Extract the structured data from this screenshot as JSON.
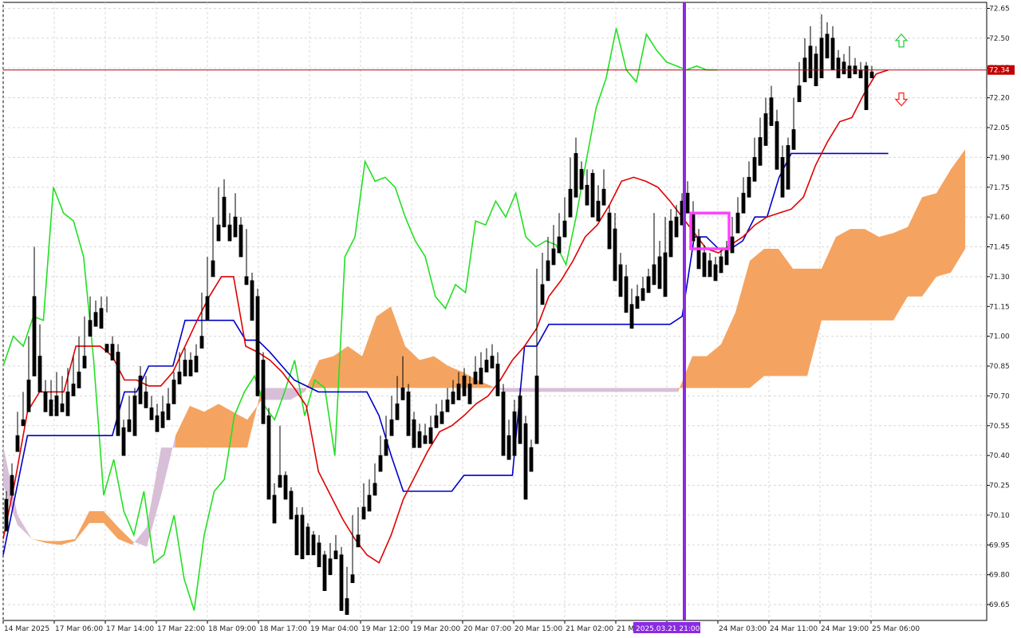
{
  "chart_data": {
    "type": "candlestick",
    "y_axis": {
      "min": 69.57,
      "max": 72.68,
      "ticks": [
        "72.65",
        "72.50",
        "72.35",
        "72.20",
        "72.05",
        "71.90",
        "71.75",
        "71.60",
        "71.45",
        "71.30",
        "71.15",
        "71.00",
        "70.85",
        "70.70",
        "70.55",
        "70.40",
        "70.25",
        "70.10",
        "69.95",
        "69.80",
        "69.65"
      ],
      "current_price": "72.34"
    },
    "x_axis": {
      "labels": [
        "14 Mar 2025",
        "17 Mar 06:00",
        "17 Mar 14:00",
        "17 Mar 22:00",
        "18 Mar 09:00",
        "18 Mar 17:00",
        "19 Mar 04:00",
        "19 Mar 12:00",
        "19 Mar 20:00",
        "20 Mar 07:00",
        "20 Mar 15:00",
        "21 Mar 02:00",
        "21 Mar 10:00",
        "2025.03.21 21:00",
        "24 Mar 03:00",
        "24 Mar 11:00",
        "24 Mar 19:00",
        "25 Mar 06:00"
      ],
      "highlight_label": "2025.03.21 21:00"
    },
    "grid": true,
    "candles": [
      [
        70.18,
        70.22,
        70.05,
        70.02
      ],
      [
        70.3,
        70.36,
        70.22,
        70.2
      ],
      [
        70.5,
        70.62,
        70.44,
        70.42
      ],
      [
        70.58,
        70.72,
        70.56,
        70.55
      ],
      [
        70.78,
        71.0,
        70.65,
        70.62
      ],
      [
        71.2,
        71.45,
        70.82,
        70.8
      ],
      [
        70.9,
        71.06,
        70.78,
        70.72
      ],
      [
        70.72,
        70.78,
        70.66,
        70.62
      ],
      [
        70.68,
        70.78,
        70.62,
        70.6
      ],
      [
        70.7,
        70.82,
        70.62,
        70.6
      ],
      [
        70.66,
        70.8,
        70.66,
        70.62
      ],
      [
        70.72,
        70.84,
        70.66,
        70.6
      ],
      [
        70.76,
        70.9,
        70.72,
        70.7
      ],
      [
        70.82,
        71.0,
        70.76,
        70.74
      ],
      [
        70.9,
        71.1,
        70.88,
        70.84
      ],
      [
        71.08,
        71.2,
        71.05,
        71.0
      ],
      [
        71.12,
        71.18,
        71.1,
        71.05
      ],
      [
        71.14,
        71.2,
        71.12,
        71.04
      ],
      [
        70.96,
        71.2,
        71.12,
        70.92
      ],
      [
        70.96,
        71.0,
        70.92,
        70.88
      ],
      [
        70.92,
        70.96,
        70.52,
        70.5
      ],
      [
        70.54,
        70.58,
        70.5,
        70.4
      ],
      [
        70.58,
        70.7,
        70.56,
        70.52
      ],
      [
        70.7,
        70.74,
        70.54,
        70.5
      ],
      [
        70.8,
        70.85,
        70.7,
        70.66
      ],
      [
        70.72,
        70.8,
        70.68,
        70.64
      ],
      [
        70.64,
        70.7,
        70.6,
        70.58
      ],
      [
        70.6,
        70.66,
        70.56,
        70.52
      ],
      [
        70.62,
        70.7,
        70.58,
        70.54
      ],
      [
        70.66,
        70.74,
        70.62,
        70.58
      ],
      [
        70.78,
        70.82,
        70.7,
        70.66
      ],
      [
        70.82,
        70.92,
        70.8,
        70.76
      ],
      [
        70.88,
        70.94,
        70.84,
        70.8
      ],
      [
        70.88,
        70.92,
        70.84,
        70.8
      ],
      [
        70.9,
        70.96,
        70.88,
        70.82
      ],
      [
        71.0,
        71.22,
        70.98,
        70.94
      ],
      [
        71.2,
        71.4,
        71.1,
        71.08
      ],
      [
        71.38,
        71.6,
        71.34,
        71.3
      ],
      [
        71.56,
        71.75,
        71.52,
        71.48
      ],
      [
        71.7,
        71.79,
        71.58,
        71.55
      ],
      [
        71.56,
        71.62,
        71.52,
        71.48
      ],
      [
        71.6,
        71.72,
        71.58,
        71.5
      ],
      [
        71.56,
        71.6,
        71.44,
        71.4
      ],
      [
        71.3,
        71.54,
        71.3,
        71.26
      ],
      [
        71.28,
        71.32,
        71.12,
        71.08
      ],
      [
        71.2,
        71.24,
        70.98,
        70.7
      ],
      [
        70.88,
        70.92,
        70.6,
        70.56
      ],
      [
        70.6,
        70.64,
        70.22,
        70.18
      ],
      [
        70.2,
        70.26,
        70.1,
        70.06
      ],
      [
        70.3,
        70.55,
        70.28,
        70.24
      ],
      [
        70.3,
        70.32,
        70.22,
        70.18
      ],
      [
        70.22,
        70.24,
        70.12,
        70.08
      ],
      [
        70.1,
        70.14,
        69.94,
        69.9
      ],
      [
        70.1,
        70.14,
        69.9,
        69.88
      ],
      [
        70.04,
        70.06,
        69.96,
        69.9
      ],
      [
        70.0,
        70.02,
        69.94,
        69.9
      ],
      [
        69.96,
        70.0,
        69.88,
        69.84
      ],
      [
        69.9,
        69.92,
        69.76,
        69.72
      ],
      [
        69.88,
        69.96,
        69.86,
        69.8
      ],
      [
        69.92,
        70.0,
        69.9,
        69.88
      ],
      [
        69.9,
        69.94,
        69.66,
        69.62
      ],
      [
        69.68,
        69.84,
        69.64,
        69.6
      ],
      [
        69.8,
        70.1,
        69.78,
        69.76
      ],
      [
        70.0,
        70.14,
        69.98,
        69.94
      ],
      [
        70.14,
        70.26,
        70.12,
        70.08
      ],
      [
        70.2,
        70.28,
        70.16,
        70.12
      ],
      [
        70.26,
        70.36,
        70.22,
        70.2
      ],
      [
        70.4,
        70.5,
        70.36,
        70.32
      ],
      [
        70.48,
        70.6,
        70.44,
        70.4
      ],
      [
        70.58,
        70.7,
        70.54,
        70.5
      ],
      [
        70.66,
        70.8,
        70.62,
        70.58
      ],
      [
        70.74,
        70.9,
        70.72,
        70.68
      ],
      [
        70.72,
        70.76,
        70.56,
        70.5
      ],
      [
        70.58,
        70.62,
        70.48,
        70.44
      ],
      [
        70.52,
        70.56,
        70.48,
        70.44
      ],
      [
        70.5,
        70.56,
        70.48,
        70.46
      ],
      [
        70.54,
        70.6,
        70.5,
        70.46
      ],
      [
        70.6,
        70.66,
        70.58,
        70.54
      ],
      [
        70.62,
        70.68,
        70.58,
        70.56
      ],
      [
        70.68,
        70.74,
        70.64,
        70.62
      ],
      [
        70.72,
        70.78,
        70.7,
        70.66
      ],
      [
        70.76,
        70.82,
        70.72,
        70.68
      ],
      [
        70.8,
        70.84,
        70.72,
        70.7
      ],
      [
        70.76,
        70.8,
        70.7,
        70.66
      ],
      [
        70.82,
        70.9,
        70.78,
        70.76
      ],
      [
        70.84,
        70.92,
        70.8,
        70.76
      ],
      [
        70.88,
        70.94,
        70.86,
        70.82
      ],
      [
        70.9,
        70.96,
        70.88,
        70.84
      ],
      [
        70.86,
        70.92,
        70.74,
        70.7
      ],
      [
        70.72,
        70.76,
        70.46,
        70.4
      ],
      [
        70.5,
        70.58,
        70.42,
        70.38
      ],
      [
        70.62,
        70.68,
        70.44,
        70.4
      ],
      [
        70.7,
        70.74,
        70.5,
        70.46
      ],
      [
        70.56,
        70.6,
        70.3,
        70.18
      ],
      [
        70.44,
        70.48,
        70.36,
        70.32
      ],
      [
        70.8,
        71.34,
        70.5,
        70.46
      ],
      [
        71.26,
        71.42,
        71.2,
        71.16
      ],
      [
        71.38,
        71.5,
        71.32,
        71.28
      ],
      [
        71.44,
        71.56,
        71.4,
        71.36
      ],
      [
        71.5,
        71.62,
        71.44,
        71.42
      ],
      [
        71.58,
        71.7,
        71.56,
        71.5
      ],
      [
        71.74,
        71.9,
        71.64,
        71.6
      ],
      [
        71.92,
        72.0,
        71.74,
        71.7
      ],
      [
        71.84,
        71.88,
        71.78,
        71.74
      ],
      [
        71.76,
        71.84,
        71.7,
        71.66
      ],
      [
        71.82,
        71.84,
        71.64,
        71.6
      ],
      [
        71.68,
        71.76,
        71.62,
        71.58
      ],
      [
        71.74,
        71.84,
        71.7,
        71.66
      ],
      [
        71.62,
        71.66,
        71.5,
        71.44
      ],
      [
        71.54,
        71.62,
        71.32,
        71.28
      ],
      [
        71.36,
        71.42,
        71.24,
        71.2
      ],
      [
        71.3,
        71.36,
        71.18,
        71.12
      ],
      [
        71.16,
        71.24,
        71.08,
        71.04
      ],
      [
        71.2,
        71.26,
        71.18,
        71.14
      ],
      [
        71.24,
        71.3,
        71.2,
        71.18
      ],
      [
        71.3,
        71.34,
        71.26,
        71.22
      ],
      [
        71.36,
        71.62,
        71.3,
        71.26
      ],
      [
        71.4,
        71.48,
        71.3,
        71.24
      ],
      [
        71.42,
        71.6,
        71.26,
        71.2
      ],
      [
        71.58,
        71.64,
        71.44,
        71.4
      ],
      [
        71.6,
        71.66,
        71.54,
        71.5
      ],
      [
        71.68,
        71.72,
        71.6,
        71.56
      ],
      [
        71.72,
        71.78,
        71.66,
        71.62
      ],
      [
        71.62,
        71.68,
        71.52,
        71.48
      ],
      [
        71.5,
        71.54,
        71.38,
        71.34
      ],
      [
        71.42,
        71.46,
        71.34,
        71.3
      ],
      [
        71.38,
        71.42,
        71.34,
        71.3
      ],
      [
        71.36,
        71.4,
        71.32,
        71.28
      ],
      [
        71.4,
        71.44,
        71.36,
        71.32
      ],
      [
        71.44,
        71.48,
        71.4,
        71.36
      ],
      [
        71.5,
        71.6,
        71.46,
        71.42
      ],
      [
        71.62,
        71.7,
        71.56,
        71.52
      ],
      [
        71.72,
        71.8,
        71.66,
        71.62
      ],
      [
        71.8,
        71.88,
        71.74,
        71.7
      ],
      [
        71.9,
        72.0,
        71.82,
        71.78
      ],
      [
        72.0,
        72.1,
        71.9,
        71.86
      ],
      [
        72.12,
        72.2,
        72.02,
        71.96
      ],
      [
        72.2,
        72.26,
        72.12,
        72.06
      ],
      [
        72.08,
        72.14,
        71.88,
        71.84
      ],
      [
        71.9,
        71.96,
        71.74,
        71.7
      ],
      [
        71.96,
        72.0,
        71.78,
        71.74
      ],
      [
        72.04,
        72.2,
        71.98,
        71.94
      ],
      [
        72.26,
        72.38,
        72.22,
        72.18
      ],
      [
        72.4,
        72.5,
        72.32,
        72.28
      ],
      [
        72.46,
        72.56,
        72.34,
        72.3
      ],
      [
        72.42,
        72.46,
        72.32,
        72.26
      ],
      [
        72.5,
        72.62,
        72.36,
        72.3
      ],
      [
        72.52,
        72.58,
        72.44,
        72.4
      ],
      [
        72.5,
        72.56,
        72.38,
        72.34
      ],
      [
        72.4,
        72.44,
        72.34,
        72.3
      ],
      [
        72.38,
        72.42,
        72.34,
        72.32
      ],
      [
        72.36,
        72.46,
        72.32,
        72.3
      ],
      [
        72.36,
        72.4,
        72.34,
        72.32
      ],
      [
        72.34,
        72.38,
        72.32,
        72.3
      ],
      [
        72.36,
        72.38,
        72.32,
        72.14
      ],
      [
        72.33,
        72.36,
        72.32,
        72.3
      ]
    ],
    "ichimoku": {
      "tenkan": [
        69.98,
        70.28,
        70.62,
        70.72,
        70.72,
        70.72,
        70.95,
        70.95,
        70.95,
        70.9,
        70.78,
        70.78,
        70.75,
        70.75,
        70.82,
        70.95,
        71.08,
        71.2,
        71.3,
        71.3,
        70.95,
        70.92,
        70.88,
        70.82,
        70.74,
        70.65,
        70.32,
        70.2,
        70.08,
        69.98,
        69.9,
        69.86,
        70.0,
        70.18,
        70.3,
        70.42,
        70.52,
        70.55,
        70.6,
        70.66,
        70.7,
        70.78,
        70.88,
        70.95,
        71.04,
        71.2,
        71.28,
        71.38,
        71.5,
        71.56,
        71.66,
        71.78,
        71.8,
        71.78,
        71.75,
        71.68,
        71.6,
        71.52,
        71.44,
        71.42,
        71.46,
        71.5,
        71.56,
        71.6,
        71.62,
        71.64,
        71.7,
        71.86,
        71.98,
        72.08,
        72.1,
        72.22,
        72.32,
        72.34
      ],
      "kijun": [
        69.9,
        70.2,
        70.5,
        70.5,
        70.5,
        70.5,
        70.5,
        70.5,
        70.5,
        70.5,
        70.72,
        70.72,
        70.85,
        70.85,
        70.85,
        71.08,
        71.08,
        71.08,
        71.08,
        71.08,
        70.98,
        70.98,
        70.92,
        70.85,
        70.78,
        70.75,
        70.72,
        70.72,
        70.72,
        70.72,
        70.72,
        70.6,
        70.4,
        70.22,
        70.22,
        70.22,
        70.22,
        70.22,
        70.3,
        70.3,
        70.3,
        70.3,
        70.3,
        70.95,
        70.95,
        71.06,
        71.06,
        71.06,
        71.06,
        71.06,
        71.06,
        71.06,
        71.06,
        71.06,
        71.06,
        71.06,
        71.1,
        71.5,
        71.5,
        71.44,
        71.44,
        71.48,
        71.6,
        71.6,
        71.8,
        71.92,
        71.92,
        71.92,
        71.92,
        71.92,
        71.92,
        71.92,
        71.92,
        71.92
      ],
      "senkou_a": [
        70.25,
        70.05,
        69.98,
        69.97,
        69.97,
        69.98,
        70.12,
        70.12,
        70.04,
        69.97,
        69.94,
        70.2,
        70.5,
        70.65,
        70.62,
        70.66,
        70.62,
        70.58,
        70.68,
        70.68,
        70.68,
        70.72,
        70.88,
        70.9,
        70.95,
        70.9,
        71.1,
        71.15,
        70.95,
        70.88,
        70.9,
        70.85,
        70.82,
        70.78,
        70.75,
        70.72,
        70.72,
        70.72,
        70.72,
        70.72,
        70.72,
        70.72,
        70.72,
        70.72,
        70.72,
        70.72,
        70.72,
        70.72,
        70.9,
        70.9,
        70.96,
        71.12,
        71.38,
        71.44,
        71.44,
        71.34,
        71.34,
        71.34,
        71.5,
        71.54,
        71.54,
        71.5,
        71.52,
        71.55,
        71.7,
        71.72,
        71.84,
        71.94
      ],
      "senkou_b": [
        70.45,
        70.1,
        69.98,
        69.96,
        69.95,
        69.97,
        70.06,
        70.06,
        69.98,
        69.95,
        70.04,
        70.44,
        70.44,
        70.44,
        70.44,
        70.44,
        70.44,
        70.44,
        70.74,
        70.74,
        70.74,
        70.74,
        70.74,
        70.74,
        70.74,
        70.74,
        70.74,
        70.74,
        70.74,
        70.74,
        70.74,
        70.74,
        70.74,
        70.74,
        70.74,
        70.74,
        70.74,
        70.74,
        70.74,
        70.74,
        70.74,
        70.74,
        70.74,
        70.74,
        70.74,
        70.74,
        70.74,
        70.74,
        70.74,
        70.74,
        70.74,
        70.74,
        70.74,
        70.8,
        70.8,
        70.8,
        70.8,
        71.08,
        71.08,
        71.08,
        71.08,
        71.08,
        71.08,
        71.2,
        71.2,
        71.3,
        71.32,
        71.44
      ],
      "chikou": [
        70.85,
        71.0,
        70.95,
        71.1,
        71.08,
        71.75,
        71.62,
        71.58,
        71.4,
        70.88,
        70.2,
        70.38,
        70.12,
        70.0,
        70.22,
        69.86,
        69.9,
        70.1,
        69.78,
        69.62,
        70.0,
        70.22,
        70.28,
        70.6,
        70.72,
        70.8,
        70.65,
        70.58,
        70.72,
        70.88,
        70.6,
        70.78,
        70.74,
        70.4,
        71.4,
        71.5,
        71.88,
        71.78,
        71.8,
        71.75,
        71.6,
        71.48,
        71.4,
        71.2,
        71.14,
        71.26,
        71.22,
        71.58,
        71.56,
        71.68,
        71.6,
        71.72,
        71.5,
        71.45,
        71.48,
        71.46,
        71.36,
        71.6,
        71.88,
        72.15,
        72.3,
        72.55,
        72.34,
        72.28,
        72.52,
        72.44,
        72.38,
        72.36,
        72.34,
        72.36,
        72.34,
        72.34
      ]
    },
    "arrows": [
      {
        "direction": "up",
        "color": "#2ecc40"
      },
      {
        "direction": "down",
        "color": "#ff2a2a"
      }
    ],
    "colors": {
      "bull_candle": "#ffffff",
      "bear_candle": "#000000",
      "tenkan": "#e00000",
      "kijun": "#0000c8",
      "chikou": "#22e022",
      "cloud_bull": "#f4a460",
      "cloud_bear": "#d8bfd8",
      "price_line": "#c00000",
      "vertical_marker": "#8a2be2",
      "box_marker": "#ff40ff"
    }
  }
}
